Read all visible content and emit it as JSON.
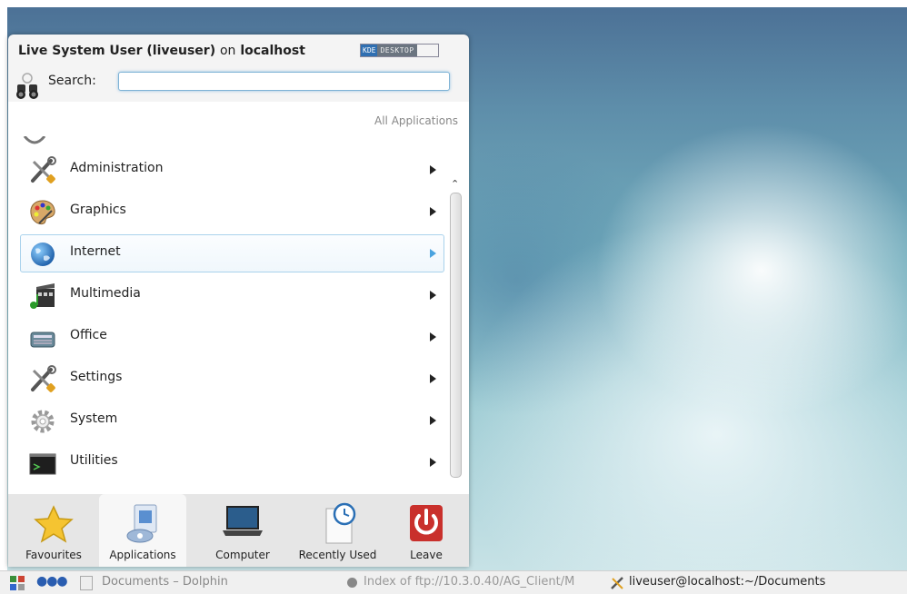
{
  "launcher": {
    "user_name": "Live System User (liveuser)",
    "user_on": "on",
    "host": "localhost",
    "badge_kde": "KDE",
    "badge_desktop": "DESKTOP",
    "search_label": "Search:",
    "search_value": "",
    "breadcrumb": "All Applications",
    "items": [
      {
        "label": "Administration",
        "icon": "tools-icon"
      },
      {
        "label": "Graphics",
        "icon": "palette-icon"
      },
      {
        "label": "Internet",
        "icon": "globe-icon"
      },
      {
        "label": "Multimedia",
        "icon": "film-music-icon"
      },
      {
        "label": "Office",
        "icon": "typewriter-icon"
      },
      {
        "label": "Settings",
        "icon": "tools-icon"
      },
      {
        "label": "System",
        "icon": "gear-icon"
      },
      {
        "label": "Utilities",
        "icon": "terminal-icon"
      }
    ],
    "active_item": "Internet",
    "tabs": [
      {
        "label": "Favourites",
        "icon": "star-icon"
      },
      {
        "label": "Applications",
        "icon": "applications-icon"
      },
      {
        "label": "Computer",
        "icon": "laptop-icon"
      },
      {
        "label": "Recently Used",
        "icon": "clock-document-icon"
      },
      {
        "label": "Leave",
        "icon": "power-icon"
      }
    ],
    "selected_tab": "Applications"
  },
  "taskbar": {
    "tasks": [
      {
        "label": "Documents – Dolphin"
      },
      {
        "label": "Index of ftp://10.3.0.40/AG_Client/M"
      },
      {
        "label": "liveuser@localhost:~/Documents"
      }
    ]
  },
  "colors": {
    "accent": "#4aa3df",
    "leave_red": "#c9302c",
    "star_yellow": "#f5c431"
  }
}
